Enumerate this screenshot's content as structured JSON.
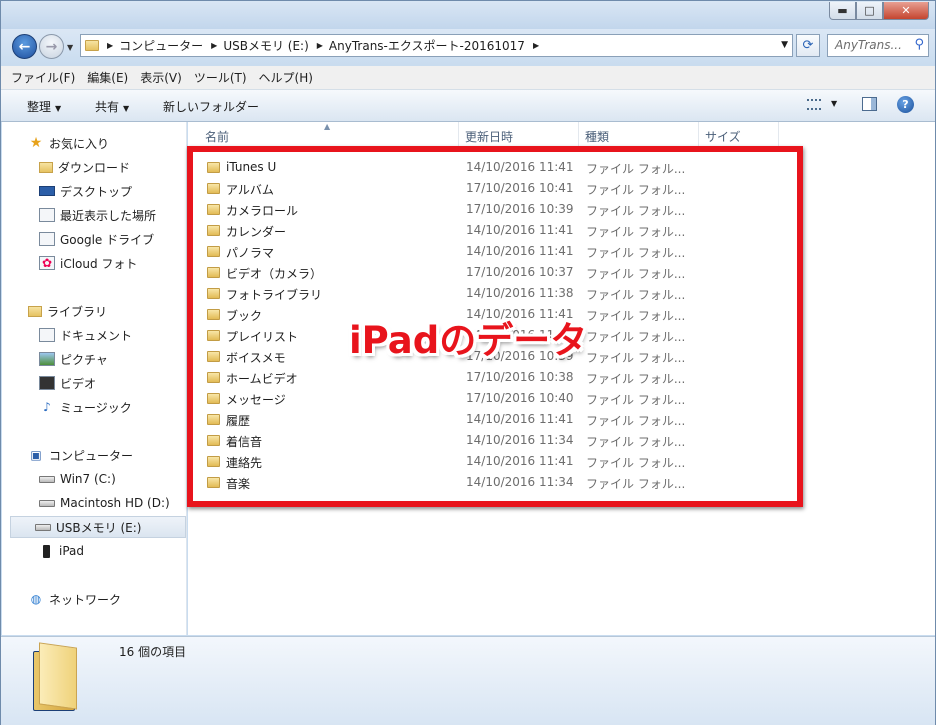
{
  "window": {
    "controls": {
      "minimize": "▬",
      "maximize": "□",
      "close": "✕"
    }
  },
  "navigation": {
    "back": "←",
    "forward": "→",
    "breadcrumbs": [
      "コンピューター",
      "USBメモリ (E:)",
      "AnyTrans-エクスポート-20161017"
    ],
    "search_placeholder": "AnyTrans...",
    "refresh_icon": "refresh-icon"
  },
  "menu": [
    "ファイル(F)",
    "編集(E)",
    "表示(V)",
    "ツール(T)",
    "ヘルプ(H)"
  ],
  "toolbar": {
    "organize": "整理",
    "share": "共有",
    "new_folder": "新しいフォルダー",
    "help": "?"
  },
  "sidebar": {
    "favorites": {
      "title": "お気に入り",
      "items": [
        "ダウンロード",
        "デスクトップ",
        "最近表示した場所",
        "Google ドライブ",
        "iCloud フォト"
      ]
    },
    "libraries": {
      "title": "ライブラリ",
      "items": [
        "ドキュメント",
        "ピクチャ",
        "ビデオ",
        "ミュージック"
      ]
    },
    "computer": {
      "title": "コンピューター",
      "items": [
        "Win7 (C:)",
        "Macintosh HD (D:)",
        "USBメモリ (E:)",
        "iPad"
      ],
      "selected": "USBメモリ (E:)"
    },
    "network": {
      "title": "ネットワーク"
    }
  },
  "columns": {
    "name": "名前",
    "date": "更新日時",
    "type": "種類",
    "size": "サイズ"
  },
  "files": [
    {
      "name": "iTunes U",
      "date": "14/10/2016 11:41",
      "type": "ファイル フォル..."
    },
    {
      "name": "アルバム",
      "date": "17/10/2016 10:41",
      "type": "ファイル フォル..."
    },
    {
      "name": "カメラロール",
      "date": "17/10/2016 10:39",
      "type": "ファイル フォル..."
    },
    {
      "name": "カレンダー",
      "date": "14/10/2016 11:41",
      "type": "ファイル フォル..."
    },
    {
      "name": "パノラマ",
      "date": "14/10/2016 11:41",
      "type": "ファイル フォル..."
    },
    {
      "name": "ビデオ（カメラ）",
      "date": "17/10/2016 10:37",
      "type": "ファイル フォル..."
    },
    {
      "name": "フォトライブラリ",
      "date": "14/10/2016 11:38",
      "type": "ファイル フォル..."
    },
    {
      "name": "ブック",
      "date": "14/10/2016 11:41",
      "type": "ファイル フォル..."
    },
    {
      "name": "プレイリスト",
      "date": "14/10/2016 11:38",
      "type": "ファイル フォル..."
    },
    {
      "name": "ボイスメモ",
      "date": "17/10/2016 10:39",
      "type": "ファイル フォル..."
    },
    {
      "name": "ホームビデオ",
      "date": "17/10/2016 10:38",
      "type": "ファイル フォル..."
    },
    {
      "name": "メッセージ",
      "date": "17/10/2016 10:40",
      "type": "ファイル フォル..."
    },
    {
      "name": "履歴",
      "date": "14/10/2016 11:41",
      "type": "ファイル フォル..."
    },
    {
      "name": "着信音",
      "date": "14/10/2016 11:34",
      "type": "ファイル フォル..."
    },
    {
      "name": "連絡先",
      "date": "14/10/2016 11:41",
      "type": "ファイル フォル..."
    },
    {
      "name": "音楽",
      "date": "14/10/2016 11:34",
      "type": "ファイル フォル..."
    }
  ],
  "overlay_text": "iPadのデータ",
  "highlight_color": "#e8141c",
  "status": {
    "count": "16 個の項目"
  }
}
